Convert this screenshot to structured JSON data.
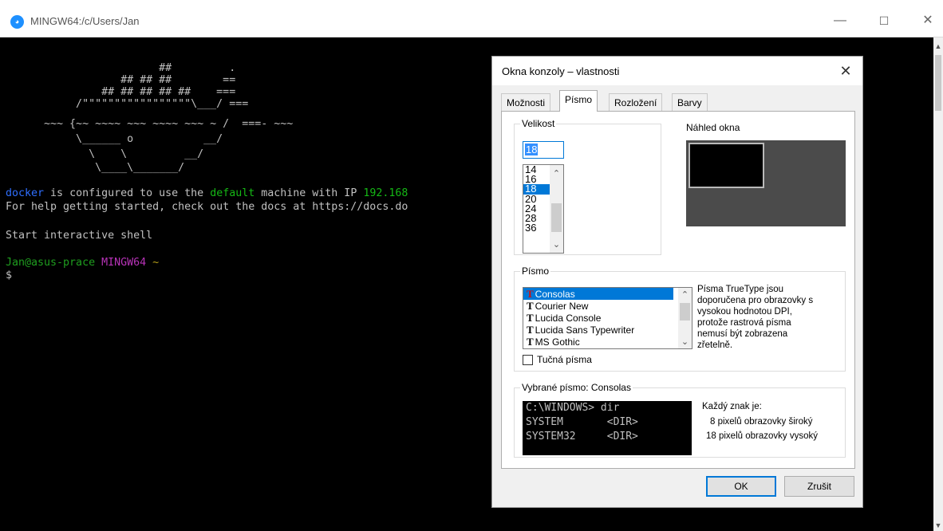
{
  "window": {
    "title": "MINGW64:/c/Users/Jan",
    "icon": "mingw-icon",
    "controls": {
      "minimize": "—",
      "maximize": "☐",
      "close": "✕"
    }
  },
  "terminal": {
    "whale_ascii": [
      "                        ##         .",
      "                  ## ## ##        ==",
      "               ## ## ## ## ##    ===",
      "           /\"\"\"\"\"\"\"\"\"\"\"\"\"\"\"\"\"\\___/ ===",
      "      ~~~ {~~ ~~~~ ~~~ ~~~~ ~~~ ~ /  ===- ~~~",
      "           \\______ o           __/",
      "             \\    \\         __/",
      "              \\____\\_______/"
    ],
    "line1": {
      "docker": "docker",
      "mid": " is configured to use the ",
      "default": "default",
      "rest": " machine with IP ",
      "ip": "192.168"
    },
    "line2": "For help getting started, check out the docs at https://docs.do",
    "line3": "Start interactive shell",
    "prompt": {
      "user": "Jan@asus-prace",
      "env": "MINGW64",
      "path": "~"
    },
    "cursor_line": "$"
  },
  "dialog": {
    "title": "Okna konzoly – vlastnosti",
    "close": "✕",
    "tabs": [
      "Možnosti",
      "Písmo",
      "Rozložení",
      "Barvy"
    ],
    "active_tab": "Písmo",
    "size_group": {
      "label": "Velikost",
      "value": "18",
      "options": [
        "14",
        "16",
        "18",
        "20",
        "24",
        "28",
        "36"
      ],
      "selected": "18"
    },
    "preview_label": "Náhled okna",
    "font_group": {
      "label": "Písmo",
      "fonts": [
        "Consolas",
        "Courier New",
        "Lucida Console",
        "Lucida Sans Typewriter",
        "MS Gothic"
      ],
      "selected": "Consolas",
      "bold_label": "Tučná písma",
      "bold_checked": false,
      "note": "Písma TrueType jsou doporučena pro obrazovky s vysokou hodnotou DPI, protože rastrová písma nemusí být zobrazena zřetelně."
    },
    "selected_font_group": {
      "label": "Vybrané písmo: Consolas",
      "sample_lines": [
        "C:\\WINDOWS> dir",
        "SYSTEM       <DIR>",
        "SYSTEM32     <DIR>"
      ],
      "char_info_title": "Každý znak je:",
      "char_width": "8 pixelů obrazovky široký",
      "char_height": "18 pixelů obrazovky vysoký"
    },
    "ok_label": "OK",
    "cancel_label": "Zrušit"
  }
}
